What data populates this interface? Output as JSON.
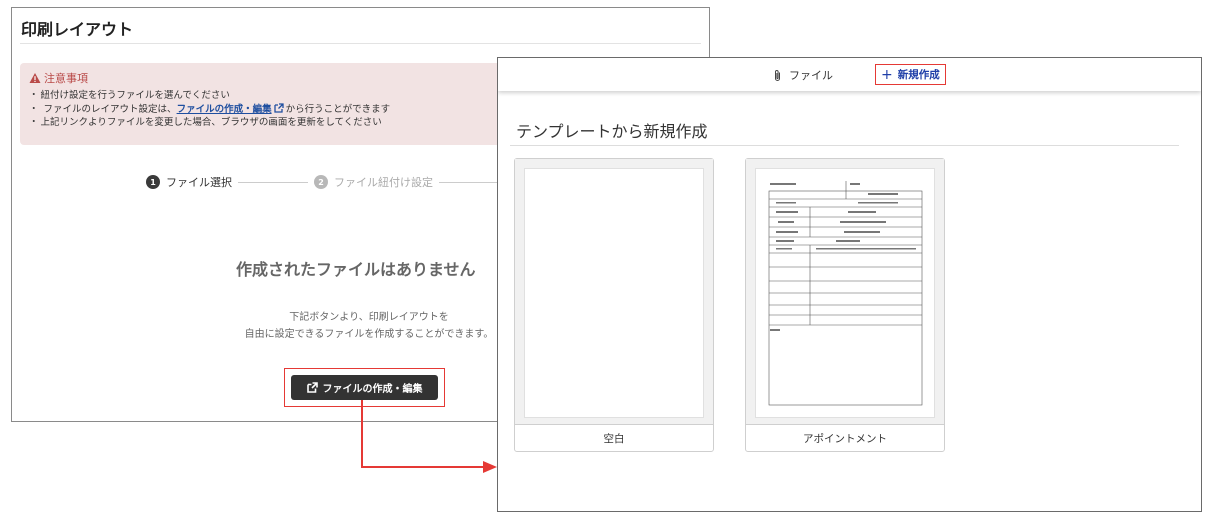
{
  "left_window": {
    "title": "印刷レイアウト",
    "notice": {
      "heading": "注意事項",
      "items": {
        "line1": "紐付け設定を行うファイルを選んでください",
        "line2_prefix": "ファイルのレイアウト設定は、",
        "line2_link": "ファイルの作成・編集",
        "line2_suffix": "から行うことができます",
        "line3": "上記リンクよりファイルを変更した場合、ブラウザの画面を更新をしてください"
      }
    },
    "stepper": {
      "step1": {
        "num": "1",
        "label": "ファイル選択"
      },
      "step2": {
        "num": "2",
        "label": "ファイル紐付け設定"
      }
    },
    "empty_title": "作成されたファイルはありません",
    "empty_desc_line1": "下記ボタンより、印刷レイアウトを",
    "empty_desc_line2": "自由に設定できるファイルを作成することができます。",
    "create_button": "ファイルの作成・編集"
  },
  "right_window": {
    "tabs": {
      "file": "ファイル",
      "new": "新規作成"
    },
    "section_title": "テンプレートから新規作成",
    "templates": [
      {
        "label": "空白"
      },
      {
        "label": "アポイントメント"
      }
    ]
  },
  "colors": {
    "highlight": "#e53935",
    "link": "#1f4fa0",
    "notice_bg": "#f2e3e3",
    "notice_text": "#b94a48"
  }
}
